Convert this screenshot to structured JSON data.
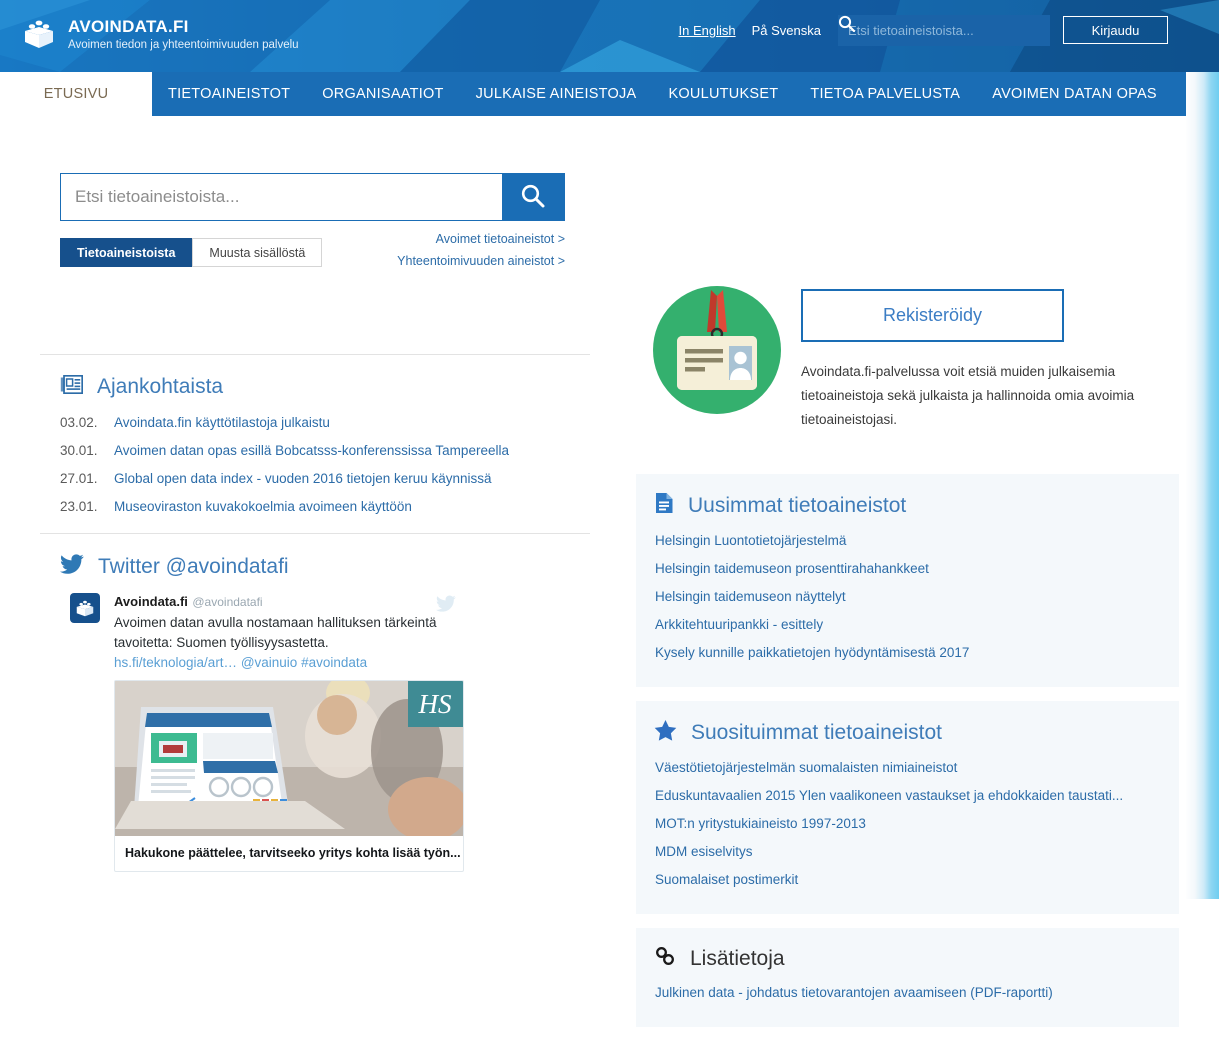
{
  "header": {
    "brand": "AVOINDATA.FI",
    "tagline": "Avoimen tiedon ja yhteentoimivuuden palvelu",
    "logo_icon": "open-data-box-icon",
    "lang_en": "In English",
    "lang_sv": "På Svenska",
    "search_placeholder": "Etsi tietoaineistoista...",
    "search_value": "",
    "search_icon": "search-icon",
    "login_label": "Kirjaudu"
  },
  "nav": {
    "items": [
      {
        "label": "ETUSIVU",
        "active": true
      },
      {
        "label": "TIETOAINEISTOT",
        "active": false
      },
      {
        "label": "ORGANISAATIOT",
        "active": false
      },
      {
        "label": "JULKAISE AINEISTOJA",
        "active": false
      },
      {
        "label": "KOULUTUKSET",
        "active": false
      },
      {
        "label": "TIETOA PALVELUSTA",
        "active": false
      },
      {
        "label": "AVOIMEN DATAN OPAS",
        "active": false
      }
    ]
  },
  "hero": {
    "search_placeholder": "Etsi tietoaineistoista...",
    "search_value": "",
    "search_button_icon": "search-icon",
    "segment_on": "Tietoaineistoista",
    "segment_off": "Muusta sisällöstä",
    "link_open_data": "Avoimet tietoaineistot >",
    "link_interop": "Yhteentoimivuuden aineistot >",
    "badge_icon": "id-card-badge-illustration",
    "register_label": "Rekisteröidy",
    "register_desc": "Avoindata.fi-palvelussa voit etsiä muiden julkaisemia tietoaineistoja sekä julkaista ja hallinnoida omia avoimia tietoaineistojasi."
  },
  "news": {
    "icon": "newspaper-icon",
    "title": "Ajankohtaista",
    "items": [
      {
        "date": "03.02.",
        "title": "Avoindata.fin käyttötilastoja julkaistu"
      },
      {
        "date": "30.01.",
        "title": "Avoimen datan opas esillä Bobcatsss-konferenssissa Tampereella"
      },
      {
        "date": "27.01.",
        "title": "Global open data index - vuoden 2016 tietojen keruu käynnissä"
      },
      {
        "date": "23.01.",
        "title": "Museoviraston kuvakokoelmia avoimeen käyttöön"
      }
    ]
  },
  "twitter": {
    "icon": "twitter-bird-icon",
    "title": "Twitter @avoindatafi",
    "tweet": {
      "avatar_icon": "avoindata-box-avatar",
      "author": "Avoindata.fi",
      "handle": "@avoindatafi",
      "text": "Avoimen datan avulla nostamaan hallituksen tärkeintä tavoitetta: Suomen työllisyysastetta.",
      "link": "hs.fi/teknologia/art…",
      "mention": "@vainuio",
      "hashtag": "#avoindata",
      "card_badge": "HS",
      "card_caption": "Hakukone päättelee, tarvitseeko yritys kohta lisää työn..."
    }
  },
  "latest": {
    "icon": "document-icon",
    "title": "Uusimmat tietoaineistot",
    "items": [
      "Helsingin Luontotietojärjestelmä",
      "Helsingin taidemuseon prosenttirahahankkeet",
      "Helsingin taidemuseon näyttelyt",
      "Arkkitehtuuripankki - esittely",
      "Kysely kunnille paikkatietojen hyödyntämisestä 2017"
    ]
  },
  "popular": {
    "icon": "star-icon",
    "title": "Suosituimmat tietoaineistot",
    "items": [
      "Väestötietojärjestelmän suomalaisten nimiaineistot",
      "Eduskuntavaalien 2015 Ylen vaalikoneen vastaukset ja ehdokkaiden taustati...",
      "MOT:n yritystukiaineisto 1997-2013",
      "MDM esiselvitys",
      "Suomalaiset postimerkit"
    ]
  },
  "more_info": {
    "icon": "link-chain-icon",
    "title": "Lisätietoja",
    "items": [
      "Julkinen data - johdatus tietovarantojen avaamiseen (PDF-raportti)"
    ]
  },
  "colors": {
    "brand_blue": "#1a6db5",
    "dark_blue": "#16508c",
    "link_blue": "#2c6ca8",
    "heading_blue": "#3f7cb8",
    "panel_bg": "#f4f8fb",
    "green": "#3bab6d",
    "active_tab_text": "#7a6a52"
  }
}
